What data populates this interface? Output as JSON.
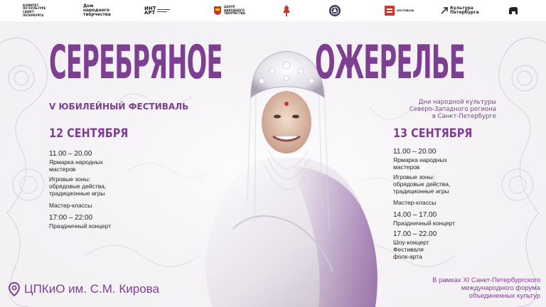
{
  "logos": [
    {
      "name": "committee-culture-logo",
      "text": "КОМИТЕТ\nПО КУЛЬТУРЕ\nСАНКТ-\nПЕТЕРБУРГА"
    },
    {
      "name": "dom-narodnogo-tvorchestva-logo",
      "text": "Дом\nнародного\nтворчества"
    },
    {
      "name": "int-art-logo",
      "text": "ИНТ\nАРТ"
    },
    {
      "name": "regional-center-logo",
      "text": "ЦЕНТР\nНАРОДНОГО\nТВОРЧЕСТВА"
    },
    {
      "name": "folk-ornament-logo",
      "text": ""
    },
    {
      "name": "round-emblem-logo",
      "text": ""
    },
    {
      "name": "red-square-logo",
      "text": "ФЕСТИВАЛЬ"
    },
    {
      "name": "kultura-peterburga-logo",
      "text": "Культура\nПетербурга"
    },
    {
      "name": "animal-emblem-logo",
      "text": ""
    }
  ],
  "title": {
    "left": "СЕРЕБРЯНОЕ",
    "right": "ОЖЕРЕЛЬЕ"
  },
  "subtitle": "V ЮБИЛЕЙНЫЙ ФЕСТИВАЛЬ",
  "tagline": [
    "Дни народной культуры",
    "Северо-Западного региона",
    "в Санкт-Петербурге"
  ],
  "day1": {
    "date": "12 СЕНТЯБРЯ",
    "items": [
      {
        "time": "11.00 – 20.00",
        "text": "Ярмарка народных\nмастеров"
      },
      {
        "time": "",
        "text": "Игровые зоны:\nобрядовые действа,\nтрадиционные игры"
      },
      {
        "time": "",
        "text": "Мастер-классы"
      },
      {
        "time": "17:00 – 22:00",
        "text": "Праздничный концерт"
      }
    ]
  },
  "day2": {
    "date": "13 СЕНТЯБРЯ",
    "items": [
      {
        "time": "11.00 – 20.00",
        "text": "Ярмарка народных\nмастеров"
      },
      {
        "time": "",
        "text": "Игровые зоны:\nобрядовые действа,\nтрадиционные игры"
      },
      {
        "time": "",
        "text": "Мастер-классы"
      },
      {
        "time": "14.00 – 17.00",
        "text": "Праздничный концерт"
      },
      {
        "time": "17.00 – 22.00",
        "text": "Шоу-концерт\nФестиваля\nфолк-арта"
      }
    ]
  },
  "venue": "ЦПКиО им. С.М. Кирова",
  "forum": [
    "В рамках XI Санкт-Петербургского",
    "международного форума",
    "объединенных культур"
  ],
  "colors": {
    "accent": "#7d3f92",
    "text": "#222222",
    "background": "#f4f1f5"
  }
}
